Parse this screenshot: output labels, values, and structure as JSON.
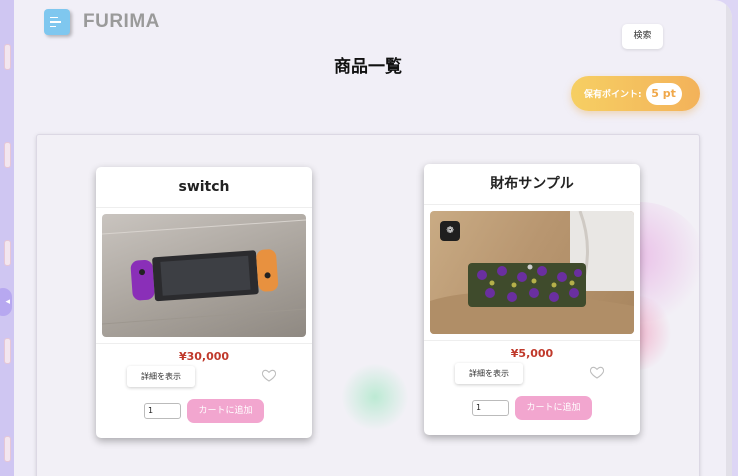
{
  "brand": {
    "name": "FURIMA",
    "logo_icon": "list-icon"
  },
  "header": {
    "search_label": "検索",
    "page_title": "商品一覧"
  },
  "points": {
    "label": "保有ポイント:",
    "value": "5 pt"
  },
  "products": [
    {
      "name": "switch",
      "image_icon": "game-console-photo",
      "price": "¥30,000",
      "detail_label": "詳細を表示",
      "quantity": "1",
      "cart_label": "カートに追加"
    },
    {
      "name": "財布サンプル",
      "image_icon": "wallet-photo",
      "price": "¥5,000",
      "detail_label": "詳細を表示",
      "quantity": "1",
      "cart_label": "カートに追加"
    }
  ],
  "colors": {
    "accent_pink": "#f2a6cf",
    "points_gold": "#f3b25a",
    "price_red": "#c0392b",
    "logo_blue": "#7fc7ef"
  }
}
